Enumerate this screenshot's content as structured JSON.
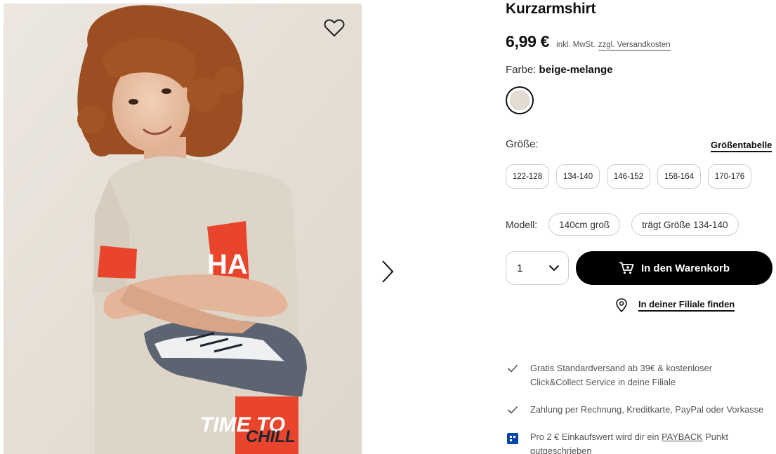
{
  "product": {
    "title": "Kurzarmshirt",
    "price": "6,99 €",
    "tax_note": "inkl. MwSt.",
    "shipping_link": "zzgl. Versandkosten",
    "image_graphic_text": {
      "line1": "TIME TO",
      "line2": "CHILL"
    }
  },
  "color": {
    "label": "Farbe:",
    "value": "beige-melange",
    "swatch_hex": "#e2dcd3"
  },
  "size": {
    "label": "Größe:",
    "chart_link": "Größentabelle",
    "options": [
      "122-128",
      "134-140",
      "146-152",
      "158-164",
      "170-176"
    ]
  },
  "model": {
    "label": "Modell:",
    "height": "140cm groß",
    "wears": "trägt Größe 134-140"
  },
  "purchase": {
    "quantity": "1",
    "add_to_cart": "In den Warenkorb",
    "store_link": "In deiner Filiale finden"
  },
  "benefits": [
    {
      "icon": "check-icon",
      "text": "Gratis Standardversand ab 39€ & kostenloser Click&Collect Service in deine Filiale"
    },
    {
      "icon": "check-icon",
      "text": "Zahlung per Rechnung, Kreditkarte, PayPal oder Vorkasse"
    },
    {
      "icon": "payback-icon",
      "text_before": "Pro 2 € Einkaufswert wird dir ein",
      "link": "PAYBACK",
      "text_after": "Punkt gutgeschrieben"
    }
  ],
  "colors": {
    "accent": "#000000",
    "payback_blue": "#0046aa",
    "graphic_red": "#e8452c"
  }
}
